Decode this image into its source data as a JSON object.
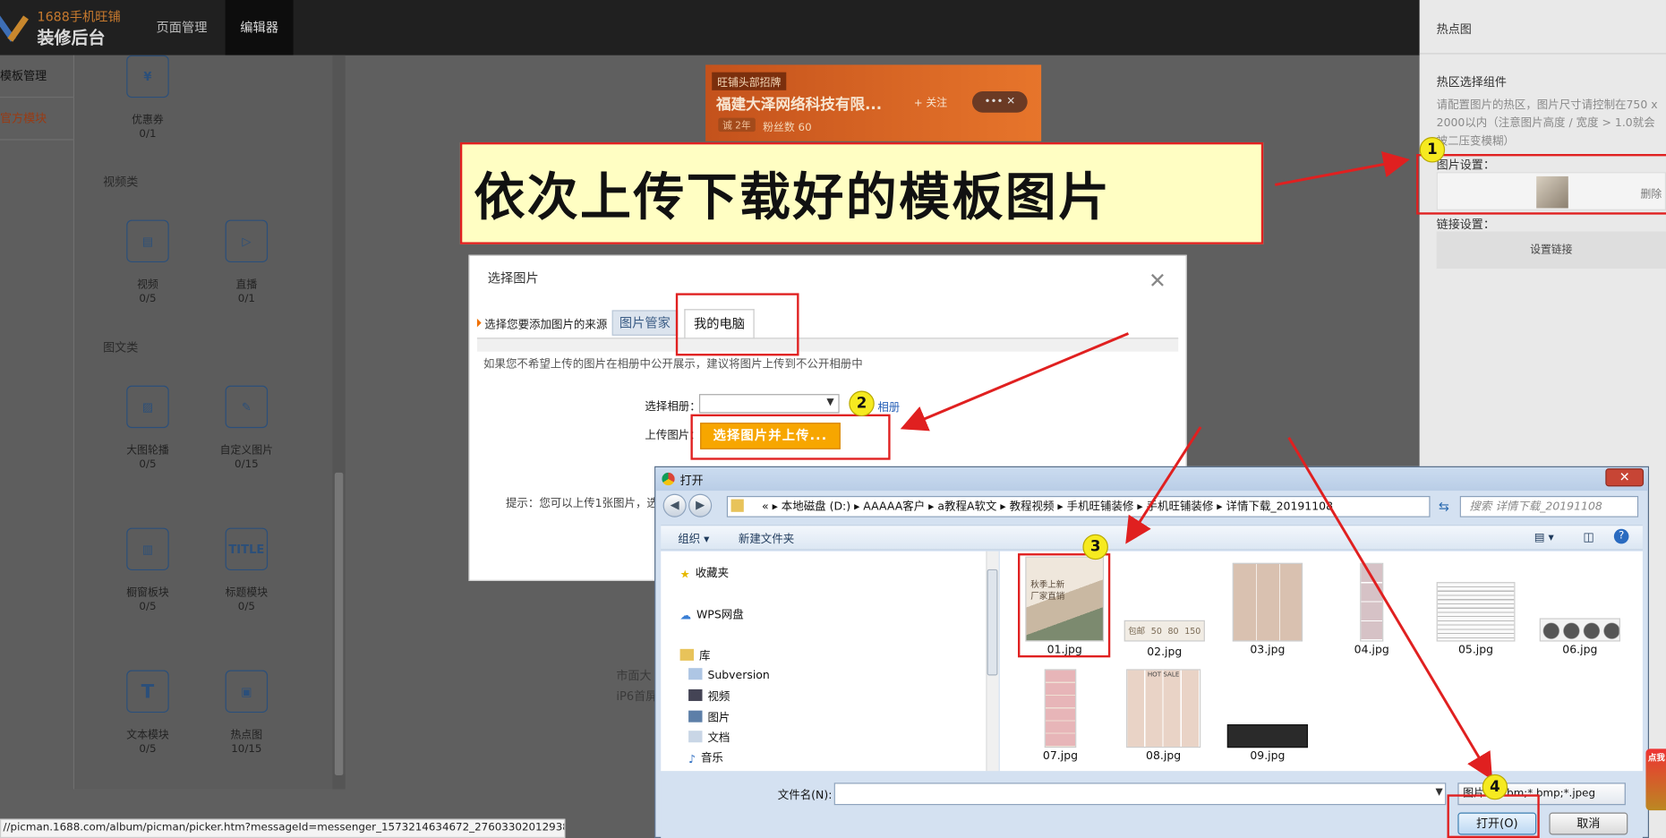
{
  "app": {
    "logo_top": "1688手机旺铺",
    "logo_bottom": "装修后台",
    "nav": [
      "页面管理",
      "编辑器"
    ]
  },
  "left_menu": [
    "模板管理",
    "官方模块"
  ],
  "widgets": {
    "categories": [
      "视频类",
      "图文类"
    ],
    "items": [
      {
        "name": "优惠券",
        "count": "0/1",
        "icon": "coupon-icon"
      },
      {
        "name": "视频",
        "count": "0/5",
        "icon": "video-icon"
      },
      {
        "name": "直播",
        "count": "0/1",
        "icon": "live-icon"
      },
      {
        "name": "大图轮播",
        "count": "0/5",
        "icon": "carousel-icon"
      },
      {
        "name": "自定义图片",
        "count": "0/15",
        "icon": "custom-image-icon"
      },
      {
        "name": "橱窗板块",
        "count": "0/5",
        "icon": "showcase-icon"
      },
      {
        "name": "标题模块",
        "count": "0/5",
        "icon": "title-icon",
        "icon_text": "TITLE"
      },
      {
        "name": "文本模块",
        "count": "0/5",
        "icon": "text-module-icon"
      },
      {
        "name": "热点图",
        "count": "10/15",
        "icon": "hotspot-icon"
      }
    ]
  },
  "shop_header": {
    "badge": "旺铺头部招牌",
    "name": "福建大泽网络科技有限...",
    "follow": "+ 关注",
    "more": "•••  ✕",
    "years": "诚 2年",
    "fans": "粉丝数 60"
  },
  "canvas_footer": [
    "市面大",
    "iP6首屏"
  ],
  "right_panel": {
    "title": "热点图",
    "component": "热区选择组件",
    "description": "请配置图片的热区，图片尺寸请控制在750 x 2000以内（注意图片高度 / 宽度 > 1.0就会被二压变模糊）",
    "image_setting": "图片设置：",
    "delete": "删除",
    "link_setting": "链接设置：",
    "link_button": "设置链接"
  },
  "banner": {
    "text": "依次上传下载好的模板图片"
  },
  "select_dialog": {
    "title": "选择图片",
    "source_label": "选择您要添加图片的来源",
    "tabs": [
      "图片管家",
      "我的电脑"
    ],
    "info": "如果您不希望上传的图片在相册中公开展示，建议将图片上传到不公开相册中",
    "album_label": "选择相册：",
    "album_new": "相册",
    "upload_label": "上传图片：",
    "upload_button": "选择图片并上传...",
    "hint": "提示：您可以上传1张图片，选"
  },
  "markers": [
    "1",
    "2",
    "3",
    "4"
  ],
  "file_dialog": {
    "title": "打开",
    "path": [
      "«",
      "本地磁盘 (D:)",
      "AAAAA客户",
      "a教程A软文",
      "教程视频",
      "手机旺铺装修",
      "手机旺铺装修",
      "详情下载_20191108"
    ],
    "search_placeholder": "搜索 详情下载_20191108",
    "toolbar": {
      "organize": "组织 ▾",
      "new_folder": "新建文件夹"
    },
    "sidebar": [
      "收藏夹",
      "WPS网盘",
      "库",
      "Subversion",
      "视频",
      "图片",
      "文档",
      "音乐"
    ],
    "files": [
      "01.jpg",
      "02.jpg",
      "03.jpg",
      "04.jpg",
      "05.jpg",
      "06.jpg",
      "07.jpg",
      "08.jpg",
      "09.jpg"
    ],
    "thumb01_text": [
      "秋季上新",
      "厂家直销"
    ],
    "thumb02_text": [
      "包邮",
      "50",
      "80",
      "150"
    ],
    "thumb08_text": "HOT SALE",
    "filename_label": "文件名(N):",
    "filename_value": "",
    "filetype": "图片 (*.xbm;*.bmp;*.jpeg",
    "open_button": "打开(O)",
    "cancel_button": "取消"
  },
  "status_url": "//picman.1688.com/album/picman/picker.htm?messageId=messenger_1573214634672_2760330201293839#",
  "float_badge": "点我"
}
